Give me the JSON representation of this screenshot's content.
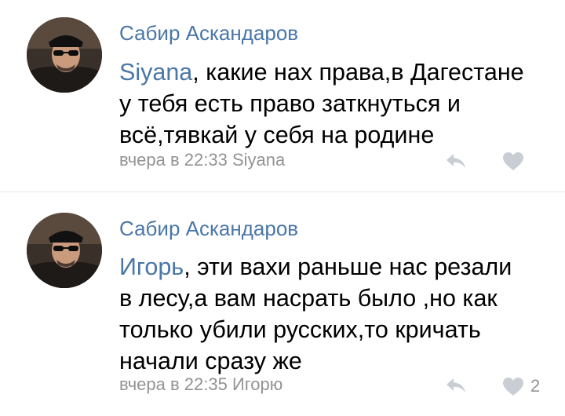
{
  "comments": [
    {
      "author": "Сабир Аскандаров",
      "mention": "Siyana",
      "text_lines": [
        ", какие нах права,в Дагестане",
        "у тебя есть право заткнуться и",
        "всё,тявкай у себя на родине"
      ],
      "meta": "вчера в 22:33 Siyana",
      "like_count": ""
    },
    {
      "author": "Сабир Аскандаров",
      "mention": "Игорь",
      "text_lines": [
        ", эти вахи раньше нас резали",
        "в лесу,а вам насрать было ,но как",
        "только убили русских,то кричать",
        "начали сразу же"
      ],
      "meta": "вчера в 22:35 Игорю",
      "like_count": "2"
    }
  ],
  "colors": {
    "link": "#4a76a8",
    "meta": "#939393",
    "icon": "#c9ced4",
    "divider": "#e3e5e8"
  },
  "icons": {
    "reply": "reply-arrow-icon",
    "like": "heart-icon"
  }
}
